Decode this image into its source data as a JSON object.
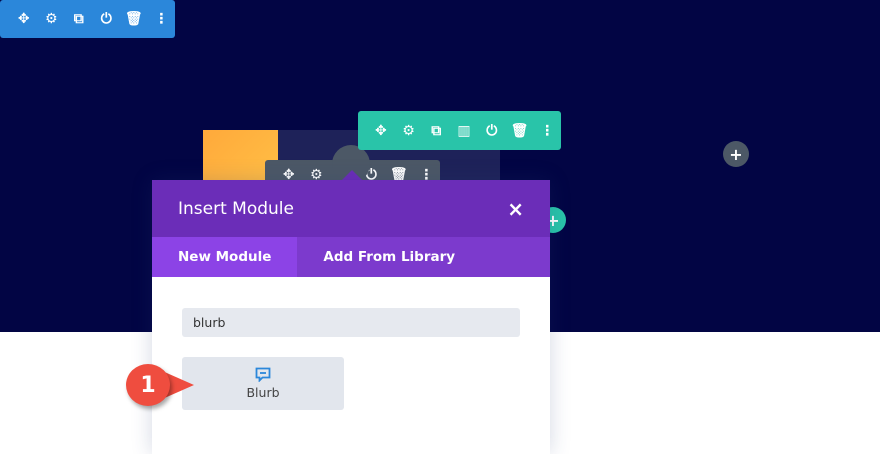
{
  "section_toolbar": {
    "icons": [
      "move-icon",
      "gear-icon",
      "duplicate-icon",
      "power-icon",
      "trash-icon",
      "more-icon"
    ]
  },
  "row_toolbar": {
    "icons": [
      "move-icon",
      "gear-icon",
      "duplicate-icon",
      "columns-icon",
      "power-icon",
      "trash-icon",
      "more-icon"
    ]
  },
  "modal": {
    "title": "Insert Module",
    "close": "×",
    "tabs": [
      {
        "label": "New Module",
        "active": true
      },
      {
        "label": "Add From Library",
        "active": false
      }
    ],
    "search_value": "blurb",
    "results": [
      {
        "label": "Blurb",
        "icon": "chat-bubble-icon"
      }
    ]
  },
  "callout": {
    "number": "1"
  },
  "colors": {
    "section": "#2b87da",
    "row": "#29c4a9",
    "modal": "#6b2db8",
    "callout": "#ef4d3f"
  }
}
